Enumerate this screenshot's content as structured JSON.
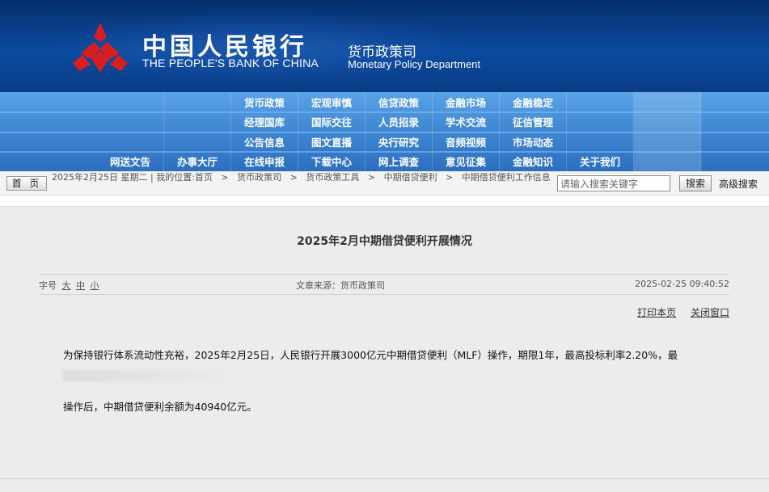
{
  "header": {
    "title_cn": "中国人民银行",
    "title_en": "THE PEOPLE'S BANK OF CHINA",
    "dept_cn": "货币政策司",
    "dept_en": "Monetary Policy Department",
    "logo_icon": "pboc-logo-icon"
  },
  "nav": {
    "rows": [
      [
        "",
        "",
        "货币政策",
        "宏观审慎",
        "信贷政策",
        "金融市场",
        "金融稳定",
        "",
        ""
      ],
      [
        "",
        "",
        "经理国库",
        "国际交往",
        "人员招录",
        "学术交流",
        "征信管理",
        "",
        ""
      ],
      [
        "",
        "",
        "公告信息",
        "图文直播",
        "央行研究",
        "音频视频",
        "市场动态",
        "",
        ""
      ],
      [
        "网送文告",
        "办事大厅",
        "在线申报",
        "下载中心",
        "网上调查",
        "意见征集",
        "金融知识",
        "关于我们",
        ""
      ]
    ]
  },
  "breadcrumb": {
    "home_label": "首 页",
    "date": "2025年2月25日 星期二",
    "location_label": "我的位置:首页",
    "path": [
      "货币政策司",
      "货币政策工具",
      "中期借贷便利",
      "中期借贷便利工作信息"
    ],
    "separator": ">"
  },
  "search": {
    "placeholder": "请输入搜索关键字",
    "button_label": "搜索",
    "advanced_label": "高级搜索"
  },
  "article": {
    "title": "2025年2月中期借贷便利开展情况",
    "font_size_label": "字号",
    "font_sizes": [
      "大",
      "中",
      "小"
    ],
    "source": "文章来源：货币政策司",
    "datetime": "2025-02-25 09:40:52",
    "print_label": "打印本页",
    "close_label": "关闭窗口",
    "paragraph1": "为保持银行体系流动性充裕，2025年2月25日，人民银行开展3000亿元中期借贷便利（MLF）操作，期限1年，最高投标利率2.20%，最",
    "paragraph2": "操作后，中期借贷便利余额为40940亿元。"
  },
  "colors": {
    "header_bg": "#0b4a9e",
    "nav_bg": "#3f86d2",
    "content_bg": "#ececec",
    "logo_red": "#d81e1e"
  }
}
